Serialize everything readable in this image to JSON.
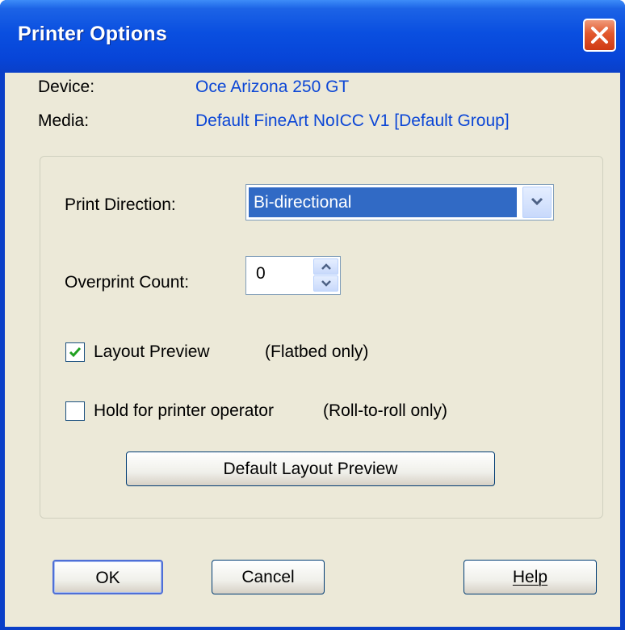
{
  "window": {
    "title": "Printer Options"
  },
  "info": {
    "device_label": "Device:",
    "device_value": "Oce Arizona 250 GT",
    "media_label": "Media:",
    "media_value": "Default FineArt NoICC V1 [Default Group]"
  },
  "options": {
    "print_direction_label": "Print Direction:",
    "print_direction_value": "Bi-directional",
    "overprint_count_label": "Overprint Count:",
    "overprint_count_value": "0",
    "layout_preview_label": "Layout Preview",
    "layout_preview_note": "(Flatbed only)",
    "layout_preview_checked": true,
    "hold_label": "Hold for printer operator",
    "hold_note": "(Roll-to-roll only)",
    "hold_checked": false,
    "default_layout_preview_button": "Default Layout Preview"
  },
  "buttons": {
    "ok": "OK",
    "cancel": "Cancel",
    "help": "Help"
  },
  "colors": {
    "title_bar": "#0a4fe0",
    "client_bg": "#ece9d8",
    "link_text": "#0b46d6",
    "selection": "#316ac5",
    "close_button": "#e2582d"
  }
}
